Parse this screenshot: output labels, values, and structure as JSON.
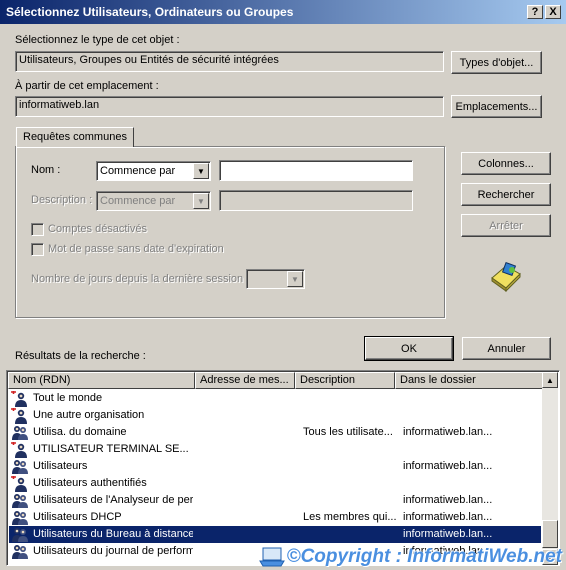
{
  "window": {
    "title": "Sélectionnez Utilisateurs, Ordinateurs ou Groupes",
    "help_btn": "?",
    "close_btn": "X"
  },
  "object_type": {
    "label": "Sélectionnez le type de cet objet :",
    "value": "Utilisateurs, Groupes ou Entités de sécurité intégrées",
    "button": "Types d'objet..."
  },
  "location": {
    "label": "À partir de cet emplacement :",
    "value": "informatiweb.lan",
    "button": "Emplacements..."
  },
  "queries": {
    "tab": "Requêtes communes",
    "name_label": "Nom :",
    "name_mode": "Commence par",
    "name_value": "",
    "desc_label": "Description :",
    "desc_mode": "Commence par",
    "desc_value": "",
    "disabled_accounts": "Comptes désactivés",
    "no_expire_pwd": "Mot de passe sans date d'expiration",
    "days_label": "Nombre de jours depuis la dernière session :",
    "days_value": ""
  },
  "buttons": {
    "columns": "Colonnes...",
    "search": "Rechercher",
    "stop": "Arrêter",
    "ok": "OK",
    "cancel": "Annuler"
  },
  "results": {
    "label": "Résultats de la recherche :",
    "columns": [
      "Nom (RDN)",
      "Adresse de mes...",
      "Description",
      "Dans le dossier"
    ],
    "rows": [
      {
        "name": "Tout le monde",
        "email": "",
        "desc": "",
        "folder": "",
        "icon": "builtin",
        "selected": false
      },
      {
        "name": "Une autre organisation",
        "email": "",
        "desc": "",
        "folder": "",
        "icon": "builtin",
        "selected": false
      },
      {
        "name": "Utilisa. du domaine",
        "email": "",
        "desc": "Tous les utilisate...",
        "folder": "informatiweb.lan...",
        "icon": "group",
        "selected": false
      },
      {
        "name": "UTILISATEUR TERMINAL SE...",
        "email": "",
        "desc": "",
        "folder": "",
        "icon": "builtin",
        "selected": false
      },
      {
        "name": "Utilisateurs",
        "email": "",
        "desc": "",
        "folder": "informatiweb.lan...",
        "icon": "group",
        "selected": false
      },
      {
        "name": "Utilisateurs authentifiés",
        "email": "",
        "desc": "",
        "folder": "",
        "icon": "builtin",
        "selected": false
      },
      {
        "name": "Utilisateurs de l'Analyseur de per...",
        "email": "",
        "desc": "",
        "folder": "informatiweb.lan...",
        "icon": "group",
        "selected": false
      },
      {
        "name": "Utilisateurs DHCP",
        "email": "",
        "desc": "Les membres qui...",
        "folder": "informatiweb.lan...",
        "icon": "group",
        "selected": false
      },
      {
        "name": "Utilisateurs du Bureau à distance",
        "email": "",
        "desc": "",
        "folder": "informatiweb.lan...",
        "icon": "group",
        "selected": true
      },
      {
        "name": "Utilisateurs du journal de perform...",
        "email": "",
        "desc": "",
        "folder": "informatiweb.lan...",
        "icon": "group",
        "selected": false
      }
    ]
  },
  "watermark": "©Copyright : InformatiWeb.net",
  "colors": {
    "title_start": "#0a246a",
    "title_end": "#a6caf0",
    "selection": "#0a246a",
    "watermark": "#4a8fe0"
  }
}
